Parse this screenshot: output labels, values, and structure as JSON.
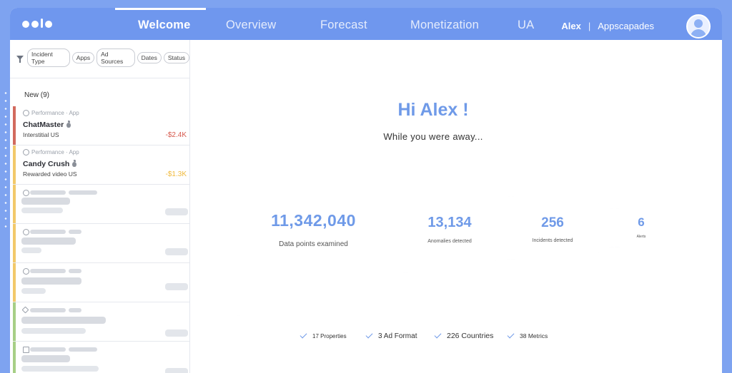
{
  "nav": {
    "tabs": [
      {
        "label": "Welcome",
        "active": true
      },
      {
        "label": "Overview"
      },
      {
        "label": "Forecast"
      },
      {
        "label": "Monetization"
      },
      {
        "label": "UA"
      }
    ],
    "user": "Alex",
    "separator": "|",
    "org": "Appscapades"
  },
  "filters": [
    "Incident Type",
    "Apps",
    "Ad Sources",
    "Dates",
    "Status"
  ],
  "incidents": {
    "new_label": "New (9)",
    "items": [
      {
        "category": "Performance · App",
        "name": "ChatMaster",
        "sub": "Interstitial US",
        "amount": "-$2.4K",
        "color": "#d26a5e",
        "amount_color": "#d6584c"
      },
      {
        "category": "Performance · App",
        "name": "Candy Crush",
        "sub": "Rewarded video US",
        "amount": "-$1.3K",
        "color": "#f2c96a",
        "amount_color": "#f0b93a"
      }
    ],
    "placeholder_colors": [
      "#f2c96a",
      "#f2c96a",
      "#f2c96a",
      "#a7cf86",
      "#a7cf86"
    ]
  },
  "welcome": {
    "greeting": "Hi Alex !",
    "subtitle": "While you were away..."
  },
  "cards": [
    {
      "value": "11,342,040",
      "label": "Data points examined"
    },
    {
      "value": "13,134",
      "label": "Anomalies detected"
    },
    {
      "value": "256",
      "label": "Incidents detected"
    },
    {
      "value": "6",
      "label": "Alerts"
    }
  ],
  "summary": [
    {
      "label": "17 Properties"
    },
    {
      "label": "3 Ad Format"
    },
    {
      "label": "226 Countries"
    },
    {
      "label": "38 Metrics"
    }
  ],
  "colors": {
    "accent": "#6f9ae8",
    "topbar": "#6f97ee",
    "background": "#7ea3f0"
  }
}
